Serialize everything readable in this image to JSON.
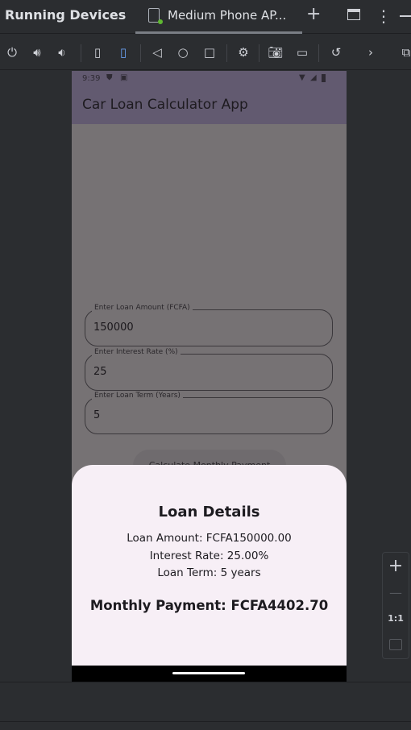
{
  "ide": {
    "panel_title": "Running Devices",
    "device_tab": "Medium Phone AP...",
    "header_icons": [
      "plus-icon",
      "window-icon",
      "more-vert-icon",
      "minimize-icon"
    ],
    "toolbar_icons": [
      "power-icon",
      "volume-up-icon",
      "volume-down-icon",
      "rotate-left-icon",
      "rotate-right-icon",
      "back-icon",
      "home-icon",
      "overview-icon",
      "device-settings-icon",
      "camera-icon",
      "video-icon",
      "reset-icon",
      "chevron-right-icon",
      "device-frame-icon"
    ],
    "zoom_controls": {
      "zoom_in": "+",
      "zoom_out": "—",
      "actual_size": "1:1",
      "fit": "fit-screen-icon"
    }
  },
  "phone": {
    "status": {
      "time": "9:39"
    },
    "app_title": "Car Loan Calculator App",
    "fields": [
      {
        "label": "Enter Loan Amount (FCFA)",
        "value": "150000"
      },
      {
        "label": "Enter Interest Rate (%)",
        "value": "25"
      },
      {
        "label": "Enter Loan Term (Years)",
        "value": "5"
      }
    ],
    "calculate_button": "Calculate Monthly Payment",
    "sheet": {
      "title": "Loan Details",
      "amount": "Loan Amount: FCFA150000.00",
      "rate": "Interest Rate: 25.00%",
      "term": "Loan Term: 5 years",
      "monthly": "Monthly Payment: FCFA4402.70"
    }
  },
  "colors": {
    "ide_bg": "#2b2d30",
    "sheet_bg": "#f7eff6",
    "app_bar": "#625a70",
    "scrim": "#767274"
  }
}
